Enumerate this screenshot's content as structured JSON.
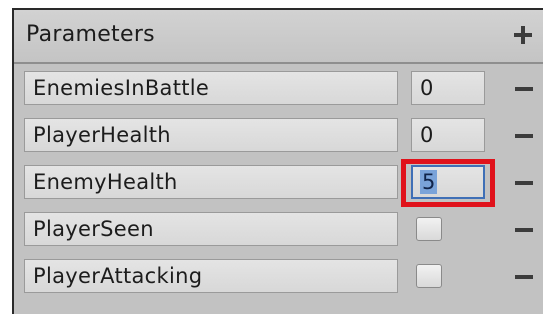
{
  "panel": {
    "title": "Parameters",
    "add_icon": "plus-icon",
    "remove_icon": "minus-icon"
  },
  "parameters": [
    {
      "name": "EnemiesInBattle",
      "type": "int",
      "value": "0",
      "selected": false
    },
    {
      "name": "PlayerHealth",
      "type": "int",
      "value": "0",
      "selected": false
    },
    {
      "name": "EnemyHealth",
      "type": "int",
      "value": "5",
      "selected": true
    },
    {
      "name": "PlayerSeen",
      "type": "bool",
      "checked": false
    },
    {
      "name": "PlayerAttacking",
      "type": "bool",
      "checked": false
    }
  ],
  "colors": {
    "panel_bg": "#c2c2c2",
    "highlight": "#e0121b",
    "selection": "#7aa3d9"
  }
}
